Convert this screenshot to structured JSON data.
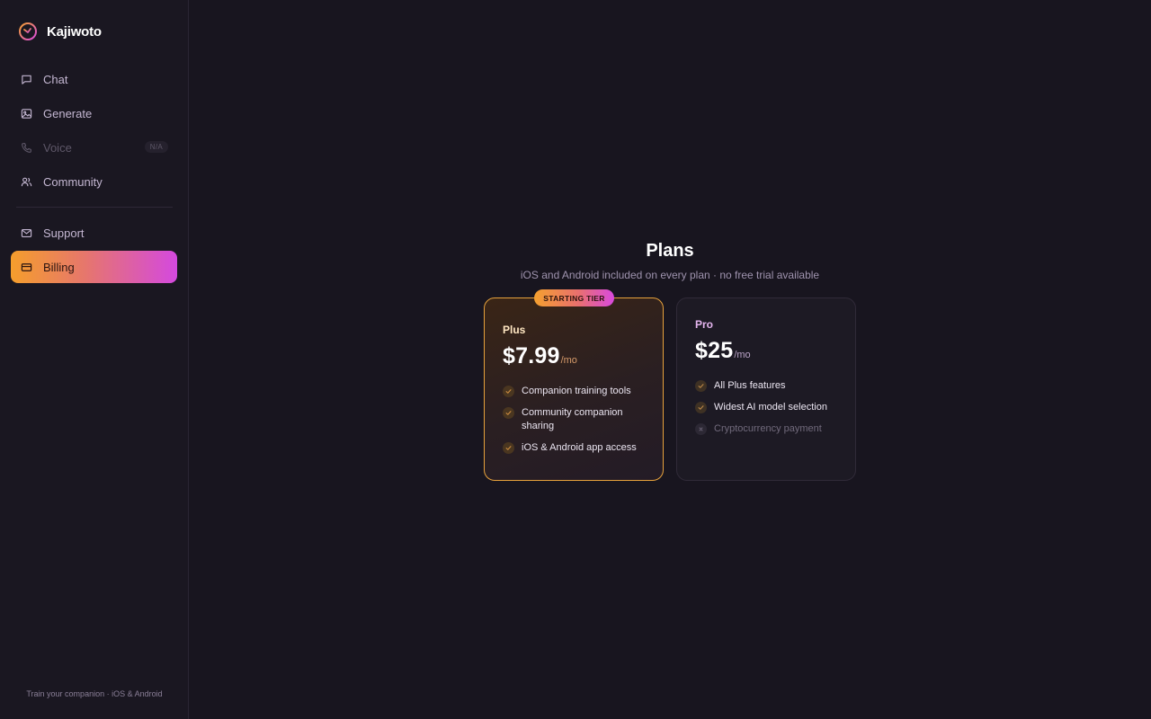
{
  "app": {
    "name": "Kajiwoto"
  },
  "sidebar": {
    "items": [
      {
        "label": "Chat",
        "icon": "chat-bubble-icon"
      },
      {
        "label": "Generate",
        "icon": "image-icon"
      },
      {
        "label": "Voice",
        "icon": "phone-icon",
        "badge": "N/A",
        "disabled": true
      },
      {
        "label": "Community",
        "icon": "users-icon"
      },
      {
        "label": "Support",
        "icon": "mail-icon"
      },
      {
        "label": "Billing",
        "icon": "credit-card-icon",
        "active": true
      }
    ],
    "footer": "Train your companion · iOS & Android"
  },
  "plans": {
    "title": "Plans",
    "subtitle": "iOS and Android included on every plan · no free trial available",
    "cards": [
      {
        "badge": "STARTING TIER",
        "name": "Plus",
        "price": "$7.99",
        "period": "/mo",
        "features": [
          {
            "text": "Companion training tools",
            "included": true
          },
          {
            "text": "Community companion sharing",
            "included": true
          },
          {
            "text": "iOS & Android app access",
            "included": true
          }
        ]
      },
      {
        "name": "Pro",
        "price": "$25",
        "period": "/mo",
        "features": [
          {
            "text": "All Plus features",
            "included": true
          },
          {
            "text": "Widest AI model selection",
            "included": true
          },
          {
            "text": "Cryptocurrency payment",
            "included": false
          }
        ]
      }
    ]
  },
  "colors": {
    "background": "#18151f",
    "accent_orange": "#f59e2c",
    "accent_pink": "#d449df",
    "plus_border": "#e7a23c"
  }
}
